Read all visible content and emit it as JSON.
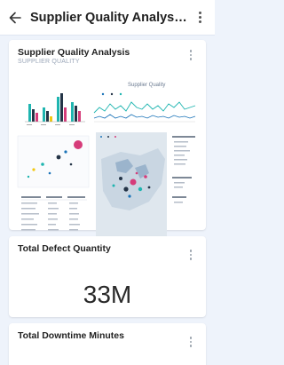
{
  "header": {
    "title": "Supplier Quality Analysis S...",
    "back_icon": "arrow-left-icon",
    "menu_icon": "more-vert-icon"
  },
  "tiles": [
    {
      "title": "Supplier Quality Analysis",
      "subtitle": "SUPPLIER QUALITY",
      "preview": {
        "line_chart_title": "Supplier Quality"
      }
    },
    {
      "title": "Total Defect Quantity",
      "value": "33M"
    },
    {
      "title": "Total Downtime Minutes"
    }
  ],
  "colors": {
    "accent_blue": "#1a73b8",
    "teal": "#1fb5b0",
    "dark_navy": "#243447",
    "magenta": "#d63c7a",
    "yellow": "#f2c811",
    "background": "#eef3fb"
  }
}
